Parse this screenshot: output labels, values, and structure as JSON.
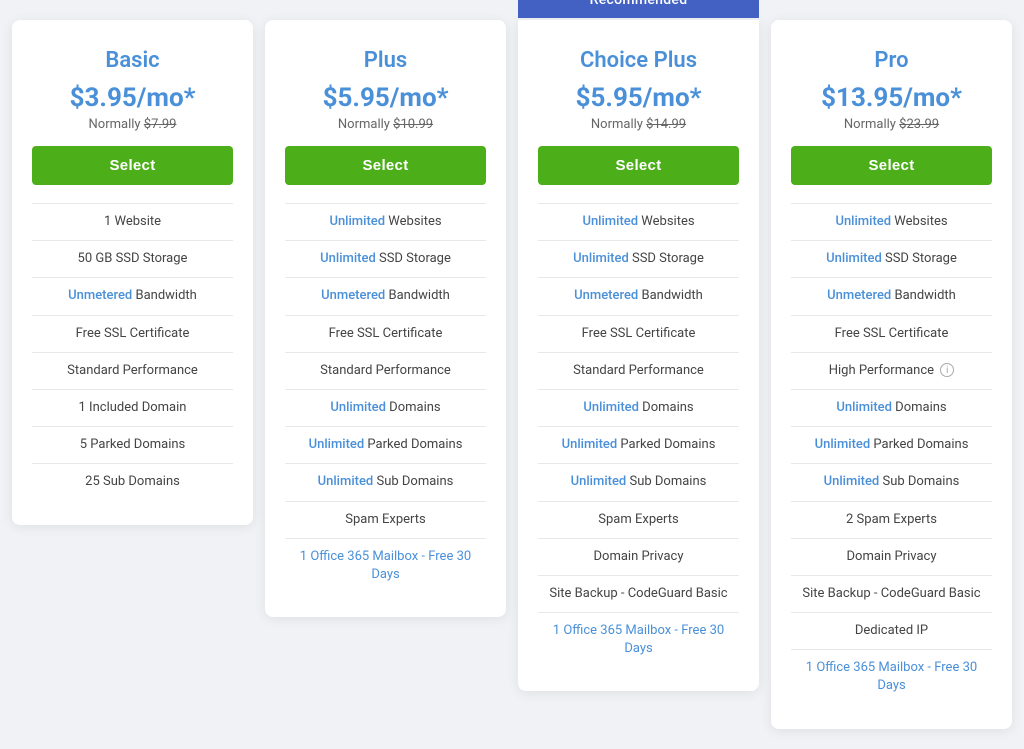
{
  "plans": [
    {
      "id": "basic",
      "name": "Basic",
      "price": "$3.95/mo*",
      "normal_price": "$7.99",
      "select_label": "Select",
      "recommended": false,
      "features": [
        {
          "text": "1 Website",
          "highlight": false
        },
        {
          "text": "50 GB SSD Storage",
          "highlight": false
        },
        {
          "prefix": "",
          "highlight_text": "Unmetered",
          "suffix": " Bandwidth"
        },
        {
          "text": "Free SSL Certificate",
          "highlight": false
        },
        {
          "text": "Standard Performance",
          "highlight": false
        },
        {
          "text": "1 Included Domain",
          "highlight": false
        },
        {
          "text": "5 Parked Domains",
          "highlight": false
        },
        {
          "text": "25 Sub Domains",
          "highlight": false
        }
      ]
    },
    {
      "id": "plus",
      "name": "Plus",
      "price": "$5.95/mo*",
      "normal_price": "$10.99",
      "select_label": "Select",
      "recommended": false,
      "features": [
        {
          "prefix": "",
          "highlight_text": "Unlimited",
          "suffix": " Websites"
        },
        {
          "prefix": "",
          "highlight_text": "Unlimited",
          "suffix": " SSD Storage"
        },
        {
          "prefix": "",
          "highlight_text": "Unmetered",
          "suffix": " Bandwidth"
        },
        {
          "text": "Free SSL Certificate",
          "highlight": false
        },
        {
          "text": "Standard Performance",
          "highlight": false
        },
        {
          "prefix": "",
          "highlight_text": "Unlimited",
          "suffix": " Domains"
        },
        {
          "prefix": "",
          "highlight_text": "Unlimited",
          "suffix": " Parked Domains"
        },
        {
          "prefix": "",
          "highlight_text": "Unlimited",
          "suffix": " Sub Domains"
        },
        {
          "text": "Spam Experts",
          "highlight": false
        },
        {
          "text": "1 Office 365 Mailbox - Free 30 Days",
          "highlight": true,
          "link": true
        }
      ]
    },
    {
      "id": "choice-plus",
      "name": "Choice Plus",
      "price": "$5.95/mo*",
      "normal_price": "$14.99",
      "select_label": "Select",
      "recommended": true,
      "recommended_label": "Recommended",
      "features": [
        {
          "prefix": "",
          "highlight_text": "Unlimited",
          "suffix": " Websites"
        },
        {
          "prefix": "",
          "highlight_text": "Unlimited",
          "suffix": " SSD Storage"
        },
        {
          "prefix": "",
          "highlight_text": "Unmetered",
          "suffix": " Bandwidth"
        },
        {
          "text": "Free SSL Certificate",
          "highlight": false
        },
        {
          "text": "Standard Performance",
          "highlight": false
        },
        {
          "prefix": "",
          "highlight_text": "Unlimited",
          "suffix": " Domains"
        },
        {
          "prefix": "",
          "highlight_text": "Unlimited",
          "suffix": " Parked Domains"
        },
        {
          "prefix": "",
          "highlight_text": "Unlimited",
          "suffix": " Sub Domains"
        },
        {
          "text": "Spam Experts",
          "highlight": false
        },
        {
          "text": "Domain Privacy",
          "highlight": false
        },
        {
          "text": "Site Backup - CodeGuard Basic",
          "highlight": false
        },
        {
          "text": "1 Office 365 Mailbox - Free 30 Days",
          "highlight": true,
          "link": true
        }
      ]
    },
    {
      "id": "pro",
      "name": "Pro",
      "price": "$13.95/mo*",
      "normal_price": "$23.99",
      "select_label": "Select",
      "recommended": false,
      "features": [
        {
          "prefix": "",
          "highlight_text": "Unlimited",
          "suffix": " Websites"
        },
        {
          "prefix": "",
          "highlight_text": "Unlimited",
          "suffix": " SSD Storage"
        },
        {
          "prefix": "",
          "highlight_text": "Unmetered",
          "suffix": " Bandwidth"
        },
        {
          "text": "Free SSL Certificate",
          "highlight": false
        },
        {
          "text": "High Performance",
          "highlight": false,
          "info": true
        },
        {
          "prefix": "",
          "highlight_text": "Unlimited",
          "suffix": " Domains"
        },
        {
          "prefix": "",
          "highlight_text": "Unlimited",
          "suffix": " Parked Domains"
        },
        {
          "prefix": "",
          "highlight_text": "Unlimited",
          "suffix": " Sub Domains"
        },
        {
          "text": "2 Spam Experts",
          "highlight": false
        },
        {
          "text": "Domain Privacy",
          "highlight": false
        },
        {
          "text": "Site Backup - CodeGuard Basic",
          "highlight": false
        },
        {
          "text": "Dedicated IP",
          "highlight": false
        },
        {
          "text": "1 Office 365 Mailbox - Free 30 Days",
          "highlight": true,
          "link": true
        }
      ]
    }
  ]
}
